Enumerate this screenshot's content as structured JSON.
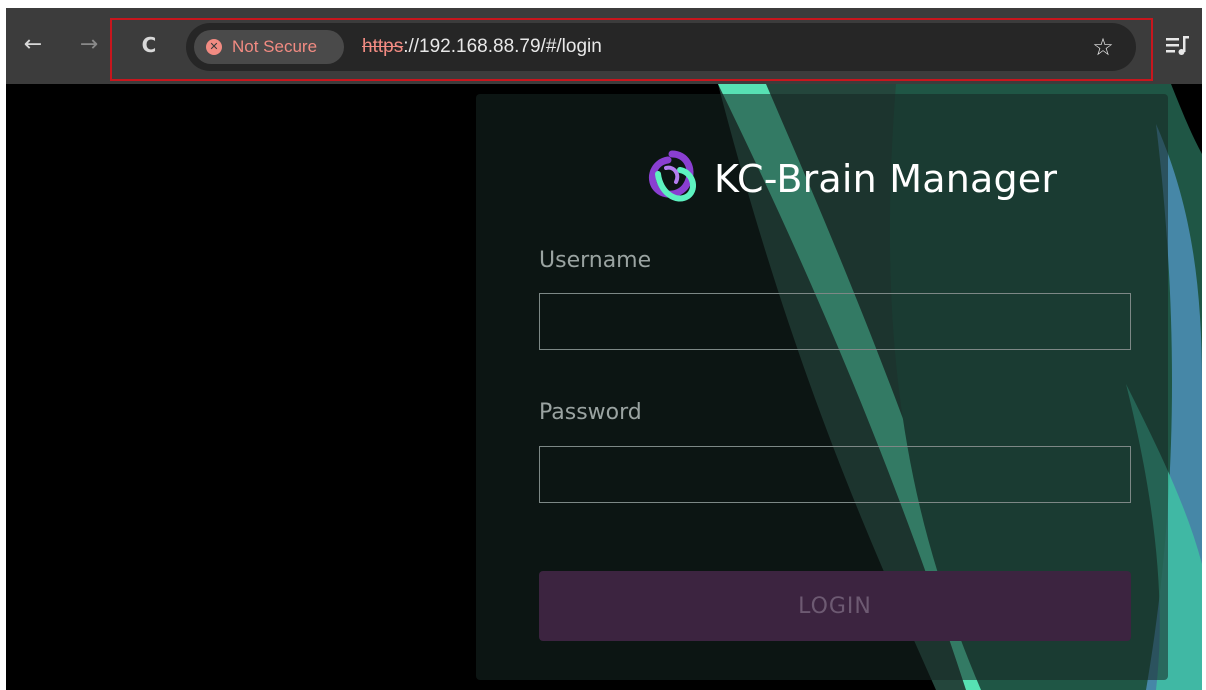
{
  "browser": {
    "back_icon": "←",
    "forward_icon": "→",
    "reload_icon": "C",
    "security_chip": {
      "icon": "✕",
      "label": "Not Secure"
    },
    "url": {
      "scheme": "https",
      "rest": "://192.168.88.79/#/login"
    },
    "bookmark_icon": "☆"
  },
  "login": {
    "brand_name": "KC-Brain Manager",
    "username_label": "Username",
    "username_value": "",
    "password_label": "Password",
    "password_value": "",
    "login_button": "LOGIN"
  },
  "colors": {
    "accent_teal": "#5df2c0",
    "accent_purple": "#8a3fd1",
    "security_warning": "#f28b82",
    "highlight_border": "#c8161d"
  }
}
